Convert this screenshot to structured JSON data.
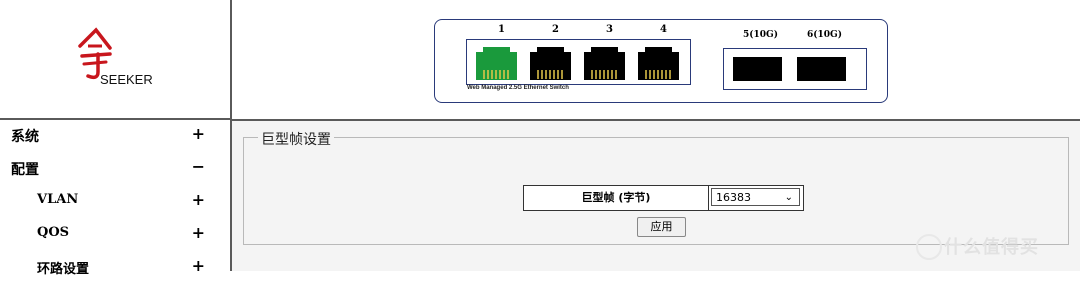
{
  "brand": {
    "name": "SEEKER"
  },
  "sidebar": {
    "items": [
      {
        "label": "系统",
        "toggle": "+"
      },
      {
        "label": "配置",
        "toggle": "−"
      },
      {
        "label": "VLAN",
        "toggle": "+"
      },
      {
        "label": "QOS",
        "toggle": "+"
      },
      {
        "label": "环路设置",
        "toggle": "+"
      }
    ]
  },
  "switch_panel": {
    "ports": [
      {
        "number": "1",
        "status_color": "#1a9a3c"
      },
      {
        "number": "2",
        "status_color": "#000000"
      },
      {
        "number": "3",
        "status_color": "#000000"
      },
      {
        "number": "4",
        "status_color": "#000000"
      }
    ],
    "sfp_ports": [
      {
        "label": "5(10G)"
      },
      {
        "label": "6(10G)"
      }
    ],
    "caption": "Web Managed 2.5G Ethernet Switch"
  },
  "main": {
    "section_title": "巨型帧设置",
    "jumbo_label": "巨型帧 (字节)",
    "jumbo_value": "16383",
    "apply_label": "应用"
  },
  "watermark": {
    "text": "什么值得买"
  }
}
